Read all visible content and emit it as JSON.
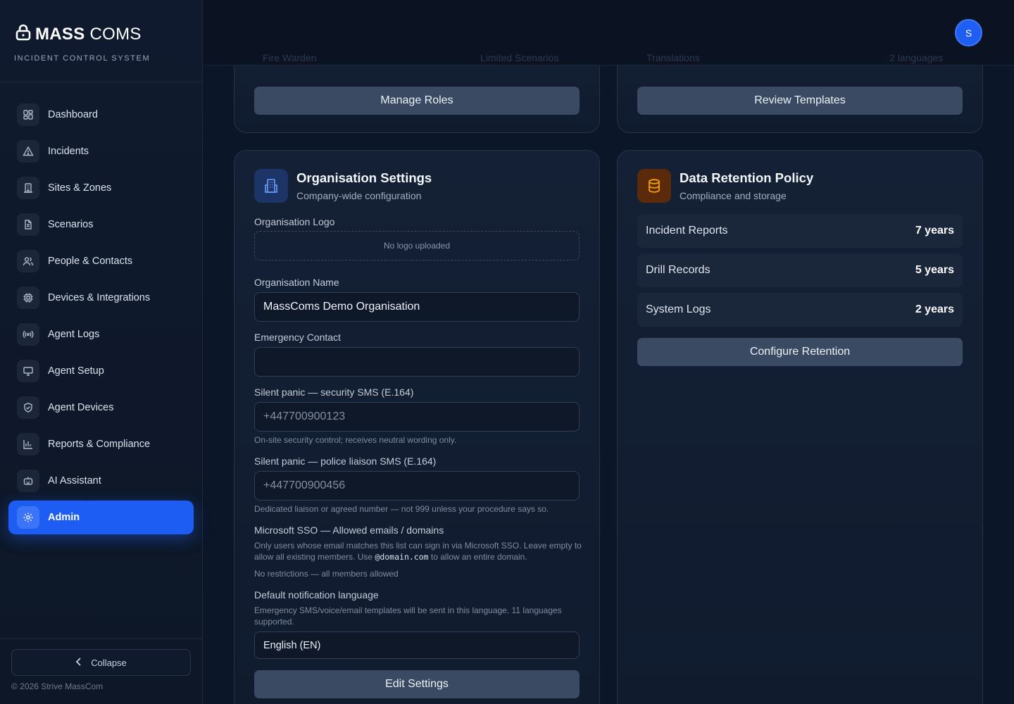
{
  "brand": {
    "title_bold": "MASS",
    "title_light": "COMS",
    "subtitle": "INCIDENT CONTROL SYSTEM"
  },
  "sidebar": {
    "items": [
      {
        "label": "Dashboard",
        "icon": "dashboard-icon"
      },
      {
        "label": "Incidents",
        "icon": "alert-triangle-icon"
      },
      {
        "label": "Sites & Zones",
        "icon": "building-icon"
      },
      {
        "label": "Scenarios",
        "icon": "document-icon"
      },
      {
        "label": "People & Contacts",
        "icon": "users-icon"
      },
      {
        "label": "Devices & Integrations",
        "icon": "chip-icon"
      },
      {
        "label": "Agent Logs",
        "icon": "broadcast-icon"
      },
      {
        "label": "Agent Setup",
        "icon": "monitor-icon"
      },
      {
        "label": "Agent Devices",
        "icon": "shield-icon"
      },
      {
        "label": "Reports & Compliance",
        "icon": "bar-chart-icon"
      },
      {
        "label": "AI Assistant",
        "icon": "bot-icon"
      },
      {
        "label": "Admin",
        "icon": "gear-icon",
        "active": true
      }
    ],
    "collapse_label": "Collapse",
    "copyright": "© 2026 Strive MassCom"
  },
  "topbar": {
    "avatar_initial": "S",
    "ghost_text": [
      "Fire Warden",
      "Limited Scenarios",
      "Translations",
      "2 languages"
    ]
  },
  "roles_card": {
    "button": "Manage Roles"
  },
  "templates_card": {
    "button": "Review Templates"
  },
  "org_settings": {
    "title": "Organisation Settings",
    "subtitle": "Company-wide configuration",
    "logo_label": "Organisation Logo",
    "logo_placeholder": "No logo uploaded",
    "name_label": "Organisation Name",
    "name_value": "MassComs Demo Organisation",
    "emergency_label": "Emergency Contact",
    "emergency_value": "",
    "security_sms_label": "Silent panic — security SMS (E.164)",
    "security_sms_placeholder": "+447700900123",
    "security_sms_hint": "On-site security control; receives neutral wording only.",
    "police_sms_label": "Silent panic — police liaison SMS (E.164)",
    "police_sms_placeholder": "+447700900456",
    "police_sms_hint": "Dedicated liaison or agreed number — not 999 unless your procedure says so.",
    "sso_label": "Microsoft SSO — Allowed emails / domains",
    "sso_hint_before": "Only users whose email matches this list can sign in via Microsoft SSO. Leave empty to allow all existing members. Use ",
    "sso_hint_code": "@domain.com",
    "sso_hint_after": " to allow an entire domain.",
    "sso_status": "No restrictions — all members allowed",
    "lang_label": "Default notification language",
    "lang_hint": "Emergency SMS/voice/email templates will be sent in this language. 11 languages supported.",
    "lang_value": "English (EN)",
    "button": "Edit Settings"
  },
  "retention": {
    "title": "Data Retention Policy",
    "subtitle": "Compliance and storage",
    "rows": [
      {
        "name": "Incident Reports",
        "value": "7 years"
      },
      {
        "name": "Drill Records",
        "value": "5 years"
      },
      {
        "name": "System Logs",
        "value": "2 years"
      }
    ],
    "button": "Configure Retention"
  },
  "colors": {
    "accent": "#1e5df3",
    "background": "#0c1629",
    "card": "#142035",
    "retention_icon_bg": "#5a2a0a",
    "retention_icon": "#f59e0b",
    "org_icon_bg": "#1d3566",
    "org_icon": "#6f9cff"
  }
}
